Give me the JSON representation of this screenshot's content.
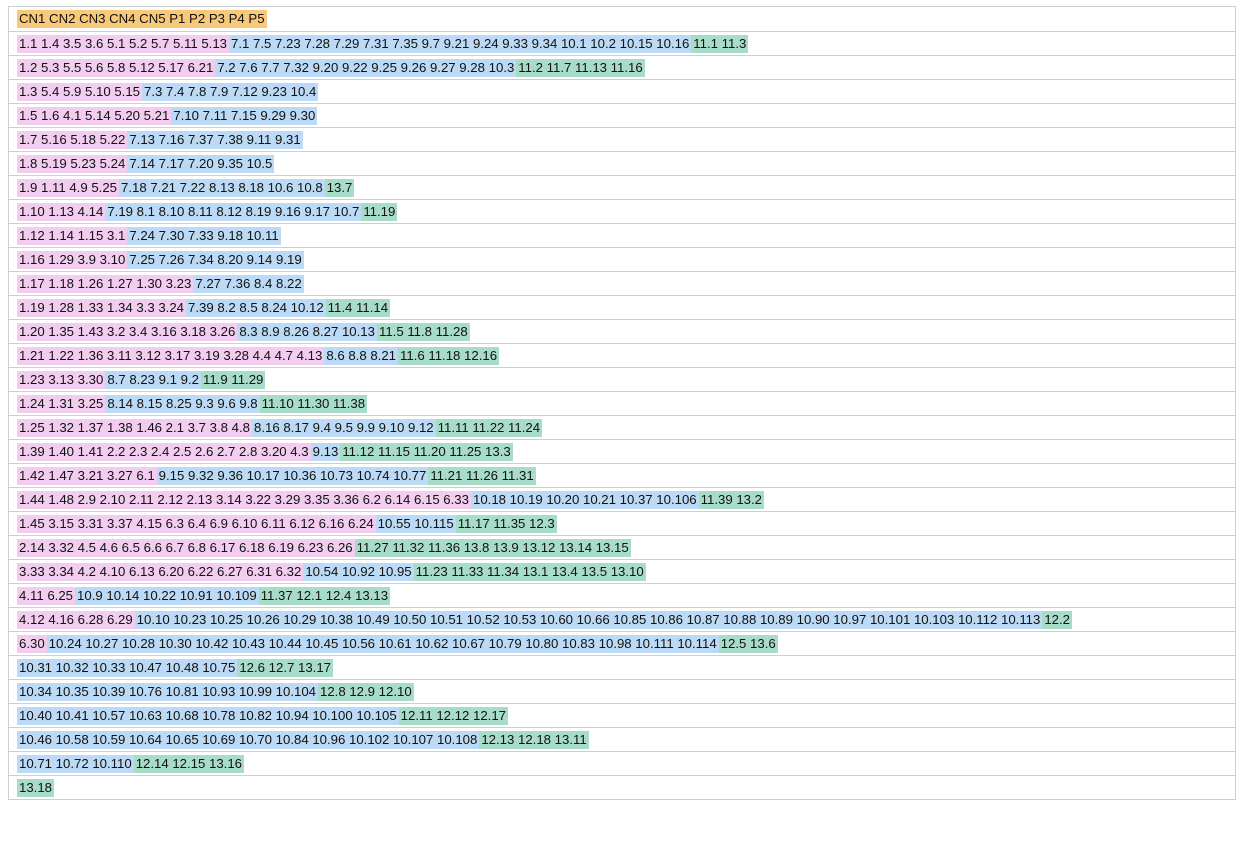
{
  "colors": {
    "header": "#f9c97a",
    "cn": "#f3cdef",
    "p_blue": "#bcdaf5",
    "p_green": "#a7ddc8"
  },
  "header": [
    "CN1 CN2 CN3 CN4 CN5 P1 P2 P3 P4 P5"
  ],
  "rows": [
    [
      "1.1 1.4 3.5 3.6 5.1 5.2 5.7 5.11 5.13",
      "7.1 7.5 7.23 7.28 7.29 7.31 7.35 9.7 9.21 9.24 9.33 9.34 10.1 10.2 10.15 10.16",
      "11.1 11.3"
    ],
    [
      "1.2 5.3 5.5 5.6 5.8 5.12 5.17 6.21",
      "7.2 7.6 7.7 7.32 9.20 9.22 9.25 9.26 9.27 9.28 10.3",
      "11.2 11.7 11.13 11.16"
    ],
    [
      "1.3 5.4 5.9 5.10 5.15",
      "7.3 7.4 7.8 7.9 7.12 9.23 10.4",
      ""
    ],
    [
      "1.5 1.6 4.1 5.14 5.20 5.21",
      "7.10 7.11 7.15 9.29 9.30",
      ""
    ],
    [
      "1.7 5.16 5.18 5.22",
      "7.13 7.16 7.37 7.38 9.11 9.31",
      ""
    ],
    [
      "1.8 5.19 5.23 5.24",
      "7.14 7.17 7.20 9.35 10.5",
      ""
    ],
    [
      "1.9 1.11 4.9 5.25",
      "7.18 7.21 7.22 8.13 8.18 10.6 10.8",
      "13.7"
    ],
    [
      "1.10 1.13 4.14",
      "7.19 8.1 8.10 8.11 8.12 8.19 9.16 9.17 10.7",
      "11.19"
    ],
    [
      "1.12 1.14 1.15 3.1",
      "7.24 7.30 7.33 9.18 10.11",
      ""
    ],
    [
      "1.16 1.29 3.9 3.10",
      "7.25 7.26 7.34 8.20 9.14 9.19",
      ""
    ],
    [
      "1.17 1.18 1.26 1.27 1.30 3.23",
      "7.27 7.36 8.4 8.22",
      ""
    ],
    [
      "1.19 1.28 1.33 1.34 3.3 3.24",
      "7.39 8.2 8.5 8.24 10.12",
      "11.4 11.14"
    ],
    [
      "1.20 1.35 1.43 3.2 3.4 3.16 3.18 3.26",
      "8.3 8.9 8.26 8.27 10.13",
      "11.5 11.8 11.28"
    ],
    [
      "1.21 1.22 1.36 3.11 3.12 3.17 3.19 3.28 4.4 4.7 4.13",
      "8.6 8.8 8.21",
      "11.6 11.18 12.16"
    ],
    [
      "1.23 3.13 3.30",
      "8.7 8.23 9.1 9.2",
      "11.9 11.29"
    ],
    [
      "1.24 1.31 3.25",
      "8.14 8.15 8.25 9.3 9.6 9.8",
      "11.10 11.30 11.38"
    ],
    [
      "1.25 1.32 1.37 1.38 1.46 2.1 3.7 3.8 4.8",
      "8.16 8.17 9.4 9.5 9.9 9.10 9.12",
      "11.11 11.22 11.24"
    ],
    [
      "1.39 1.40 1.41 2.2 2.3 2.4 2.5 2.6 2.7 2.8 3.20 4.3",
      "9.13",
      "11.12 11.15 11.20 11.25 13.3"
    ],
    [
      "1.42 1.47 3.21 3.27 6.1",
      "9.15 9.32 9.36 10.17 10.36 10.73 10.74 10.77",
      "11.21 11.26 11.31"
    ],
    [
      "1.44 1.48 2.9 2.10 2.11 2.12 2.13 3.14 3.22 3.29 3.35 3.36 6.2 6.14 6.15 6.33",
      "10.18 10.19 10.20 10.21 10.37 10.106",
      "11.39 13.2"
    ],
    [
      "1.45 3.15 3.31 3.37 4.15 6.3 6.4 6.9 6.10 6.11 6.12 6.16 6.24",
      "10.55 10.115",
      "11.17 11.35 12.3"
    ],
    [
      "2.14 3.32 4.5 4.6 6.5 6.6 6.7 6.8 6.17 6.18 6.19 6.23 6.26",
      "",
      "11.27 11.32 11.36 13.8 13.9 13.12 13.14 13.15"
    ],
    [
      "3.33 3.34 4.2 4.10 6.13 6.20 6.22 6.27 6.31 6.32",
      "10.54 10.92 10.95",
      "11.23 11.33 11.34 13.1 13.4 13.5 13.10"
    ],
    [
      "4.11 6.25",
      "10.9 10.14 10.22 10.91 10.109",
      "11.37 12.1 12.4 13.13"
    ],
    [
      "4.12 4.16 6.28 6.29",
      "10.10 10.23 10.25 10.26 10.29 10.38 10.49 10.50 10.51 10.52 10.53 10.60 10.66 10.85 10.86 10.87 10.88 10.89 10.90 10.97 10.101 10.103 10.112 10.113",
      "12.2"
    ],
    [
      "6.30",
      "10.24 10.27 10.28 10.30 10.42 10.43 10.44 10.45 10.56 10.61 10.62 10.67 10.79 10.80 10.83 10.98 10.111 10.114",
      "12.5 13.6"
    ],
    [
      "",
      "10.31 10.32 10.33 10.47 10.48 10.75",
      "12.6 12.7 13.17"
    ],
    [
      "",
      "10.34 10.35 10.39 10.76 10.81 10.93 10.99 10.104",
      "12.8 12.9 12.10"
    ],
    [
      "",
      "10.40 10.41 10.57 10.63 10.68 10.78 10.82 10.94 10.100 10.105",
      "12.11 12.12 12.17"
    ],
    [
      "",
      "10.46 10.58 10.59 10.64 10.65 10.69 10.70 10.84 10.96 10.102 10.107 10.108",
      "12.13 12.18 13.11"
    ],
    [
      "",
      "10.71 10.72 10.110",
      "12.14 12.15 13.16"
    ],
    [
      "",
      "",
      "13.18"
    ]
  ]
}
